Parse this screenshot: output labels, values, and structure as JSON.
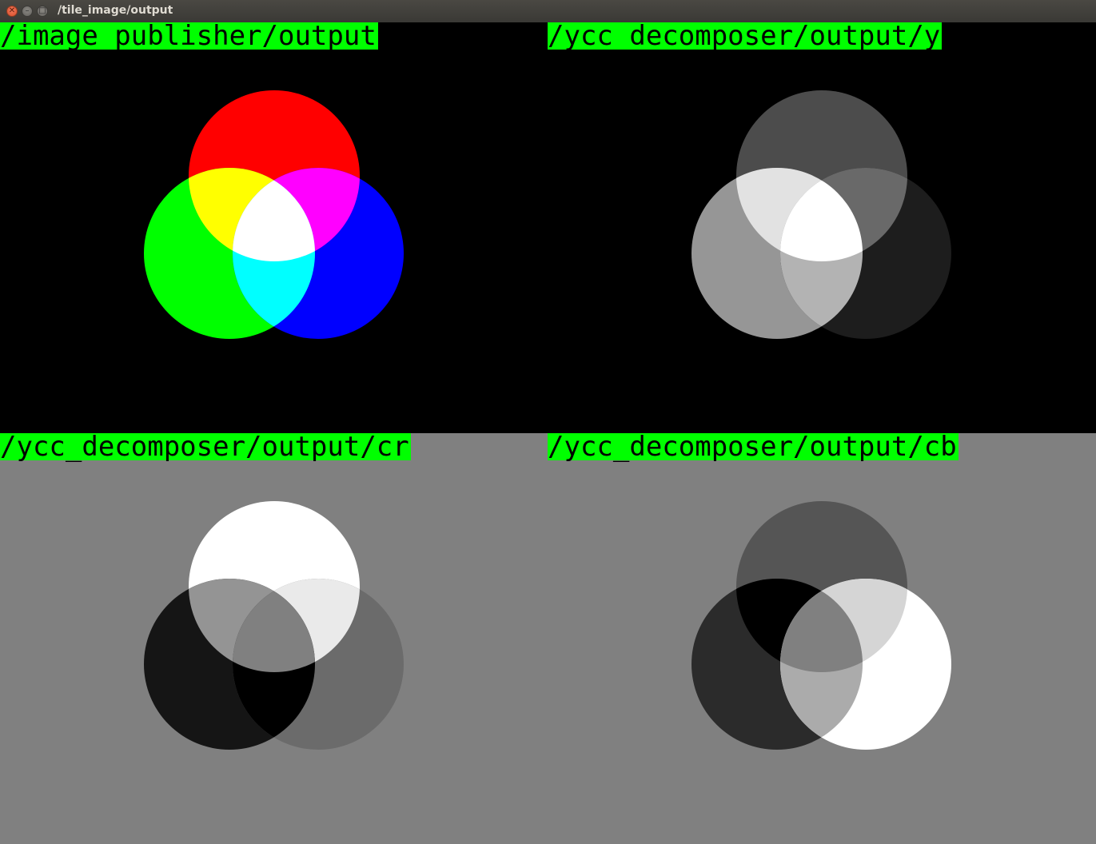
{
  "window": {
    "title": "/tile_image/output",
    "buttons": [
      "close-icon",
      "minimize-icon",
      "maximize-icon"
    ]
  },
  "tiles": [
    {
      "label": "/image_publisher/output",
      "background": "#000000",
      "regions": {
        "red": "#ff0000",
        "green": "#00ff00",
        "blue": "#0000ff",
        "red_green": "#ffff00",
        "red_blue": "#ff00ff",
        "green_blue": "#00ffff",
        "all": "#ffffff"
      }
    },
    {
      "label": "/ycc_decomposer/output/y",
      "background": "#000000",
      "regions": {
        "red": "#4c4c4c",
        "green": "#969696",
        "blue": "#1d1d1d",
        "red_green": "#e2e2e2",
        "red_blue": "#696969",
        "green_blue": "#b3b3b3",
        "all": "#ffffff"
      }
    },
    {
      "label": "/ycc_decomposer/output/cr",
      "background": "#808080",
      "regions": {
        "red": "#ffffff",
        "green": "#151515",
        "blue": "#6b6b6b",
        "red_green": "#949494",
        "red_blue": "#eaeaea",
        "green_blue": "#000000",
        "all": "#808080"
      }
    },
    {
      "label": "/ycc_decomposer/output/cb",
      "background": "#808080",
      "regions": {
        "red": "#555555",
        "green": "#2b2b2b",
        "blue": "#ffffff",
        "red_green": "#000000",
        "red_blue": "#d5d5d5",
        "green_blue": "#ababab",
        "all": "#808080"
      }
    }
  ]
}
